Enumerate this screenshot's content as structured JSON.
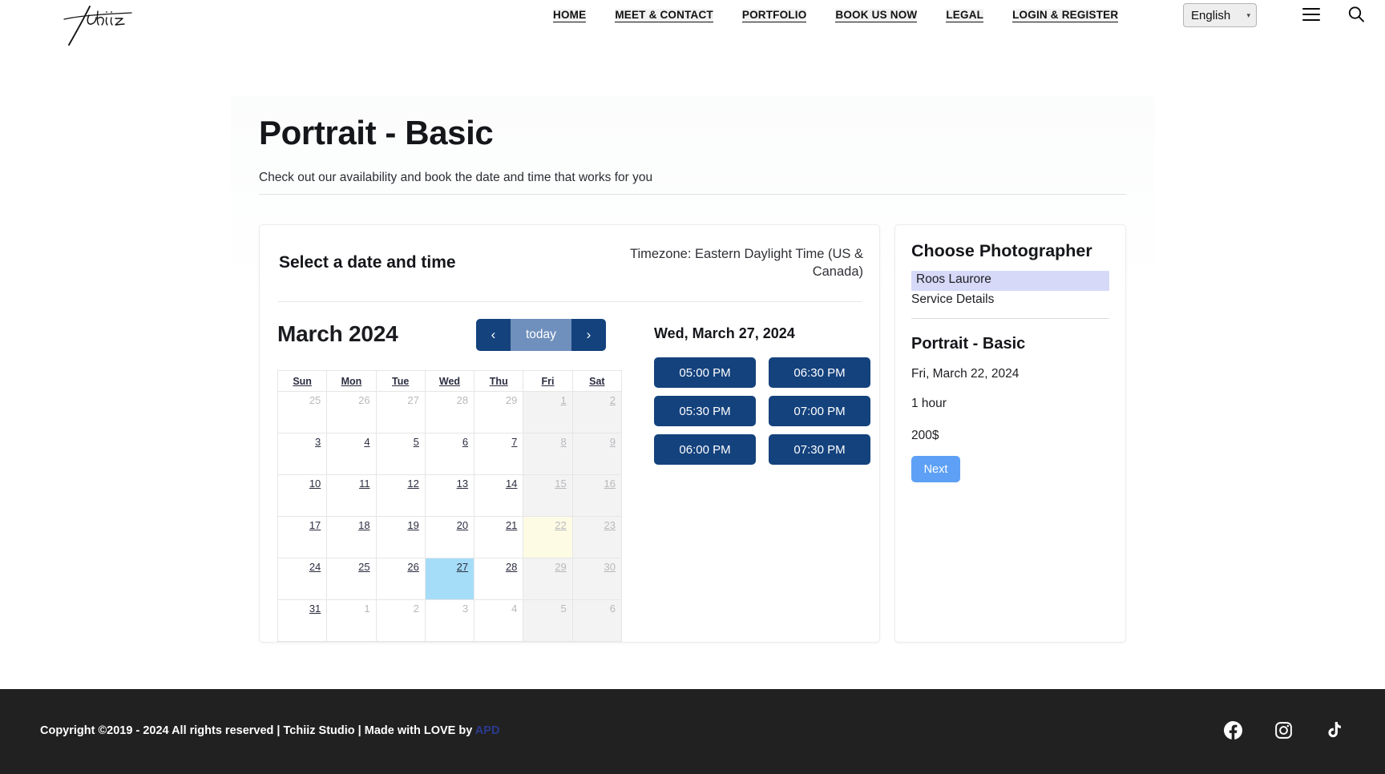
{
  "header": {
    "logo_alt": "Tchiiz",
    "nav": [
      {
        "label": "HOME"
      },
      {
        "label": "MEET & CONTACT"
      },
      {
        "label": "PORTFOLIO"
      },
      {
        "label": "BOOK US NOW"
      },
      {
        "label": "LEGAL"
      },
      {
        "label": "LOGIN & REGISTER"
      }
    ],
    "language": {
      "selected": "English",
      "options": [
        "English"
      ]
    },
    "menu_icon": "hamburger-icon",
    "search_icon": "search-icon"
  },
  "page": {
    "title": "Portrait - Basic",
    "subtitle": "Check out our availability and book the date and time that works for you"
  },
  "booking": {
    "heading": "Select a date and time",
    "timezone": "Timezone: Eastern Daylight Time (US & Canada)",
    "calendar": {
      "month_label": "March 2024",
      "prev_label": "‹",
      "today_label": "today",
      "next_label": "›",
      "weekdays": [
        "Sun",
        "Mon",
        "Tue",
        "Wed",
        "Thu",
        "Fri",
        "Sat"
      ],
      "weeks": [
        [
          {
            "day": "25",
            "state": "other"
          },
          {
            "day": "26",
            "state": "other"
          },
          {
            "day": "27",
            "state": "other"
          },
          {
            "day": "28",
            "state": "other"
          },
          {
            "day": "29",
            "state": "other"
          },
          {
            "day": "1",
            "state": "weekend-disabled"
          },
          {
            "day": "2",
            "state": "weekend-disabled"
          }
        ],
        [
          {
            "day": "3",
            "state": "available"
          },
          {
            "day": "4",
            "state": "available"
          },
          {
            "day": "5",
            "state": "available"
          },
          {
            "day": "6",
            "state": "available"
          },
          {
            "day": "7",
            "state": "available"
          },
          {
            "day": "8",
            "state": "weekend-disabled"
          },
          {
            "day": "9",
            "state": "weekend-disabled"
          }
        ],
        [
          {
            "day": "10",
            "state": "available"
          },
          {
            "day": "11",
            "state": "available"
          },
          {
            "day": "12",
            "state": "available"
          },
          {
            "day": "13",
            "state": "available"
          },
          {
            "day": "14",
            "state": "available"
          },
          {
            "day": "15",
            "state": "weekend-disabled"
          },
          {
            "day": "16",
            "state": "weekend-disabled"
          }
        ],
        [
          {
            "day": "17",
            "state": "available"
          },
          {
            "day": "18",
            "state": "available"
          },
          {
            "day": "19",
            "state": "available"
          },
          {
            "day": "20",
            "state": "available"
          },
          {
            "day": "21",
            "state": "available"
          },
          {
            "day": "22",
            "state": "highlight-disabled"
          },
          {
            "day": "23",
            "state": "weekend-disabled"
          }
        ],
        [
          {
            "day": "24",
            "state": "available"
          },
          {
            "day": "25",
            "state": "available"
          },
          {
            "day": "26",
            "state": "available"
          },
          {
            "day": "27",
            "state": "selected"
          },
          {
            "day": "28",
            "state": "available"
          },
          {
            "day": "29",
            "state": "weekend-disabled"
          },
          {
            "day": "30",
            "state": "weekend-disabled"
          }
        ],
        [
          {
            "day": "31",
            "state": "available"
          },
          {
            "day": "1",
            "state": "other"
          },
          {
            "day": "2",
            "state": "other"
          },
          {
            "day": "3",
            "state": "other"
          },
          {
            "day": "4",
            "state": "other"
          },
          {
            "day": "5",
            "state": "other-weekend"
          },
          {
            "day": "6",
            "state": "other-weekend"
          }
        ]
      ]
    },
    "slots": {
      "selected_date_label": "Wed, March 27, 2024",
      "times": [
        "05:00 PM",
        "05:30 PM",
        "06:00 PM",
        "06:30 PM",
        "07:00 PM",
        "07:30 PM"
      ]
    }
  },
  "sidebar": {
    "title": "Choose Photographer",
    "photographer_selected": "Roos Laurore",
    "service_details_label": "Service Details",
    "service_title": "Portrait - Basic",
    "service_date": "Fri, March 22, 2024",
    "service_duration": "1 hour",
    "service_price": "200$",
    "next_label": "Next"
  },
  "footer": {
    "copyright": "Copyright ©2019 - 2024 All rights reserved | Tchiiz Studio | Made with LOVE by ",
    "credit_link": "APD",
    "social": [
      {
        "name": "facebook-icon"
      },
      {
        "name": "instagram-icon"
      },
      {
        "name": "tiktok-icon"
      }
    ]
  },
  "colors": {
    "primary_blue": "#14427d",
    "today_blue": "#6f8fbc",
    "selected_day": "#a5ddf8",
    "highlight_day": "#fdfbe4",
    "photographer_highlight": "#d6daf8",
    "next_button": "#5da0f5",
    "footer_bg": "#212121"
  }
}
